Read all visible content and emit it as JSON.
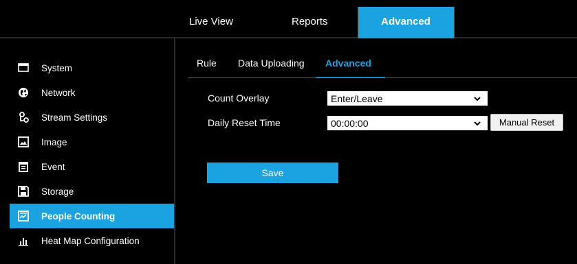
{
  "top_nav": {
    "tabs": [
      {
        "label": "Live View"
      },
      {
        "label": "Reports"
      },
      {
        "label": "Advanced",
        "active": true
      }
    ]
  },
  "sidebar": {
    "items": [
      {
        "label": "System",
        "icon": "monitor-icon"
      },
      {
        "label": "Network",
        "icon": "globe-icon"
      },
      {
        "label": "Stream Settings",
        "icon": "stream-icon"
      },
      {
        "label": "Image",
        "icon": "image-icon"
      },
      {
        "label": "Event",
        "icon": "calendar-icon"
      },
      {
        "label": "Storage",
        "icon": "floppy-icon"
      },
      {
        "label": "People Counting",
        "icon": "people-counting-icon",
        "active": true
      },
      {
        "label": "Heat Map Configuration",
        "icon": "bar-chart-icon"
      }
    ]
  },
  "sub_tabs": {
    "tabs": [
      {
        "label": "Rule"
      },
      {
        "label": "Data Uploading"
      },
      {
        "label": "Advanced",
        "active": true
      }
    ]
  },
  "form": {
    "count_overlay": {
      "label": "Count Overlay",
      "value": "Enter/Leave"
    },
    "daily_reset_time": {
      "label": "Daily Reset Time",
      "value": "00:00:00"
    },
    "manual_reset_label": "Manual Reset",
    "save_label": "Save"
  },
  "colors": {
    "accent": "#1aa3e0",
    "background": "#000000"
  }
}
